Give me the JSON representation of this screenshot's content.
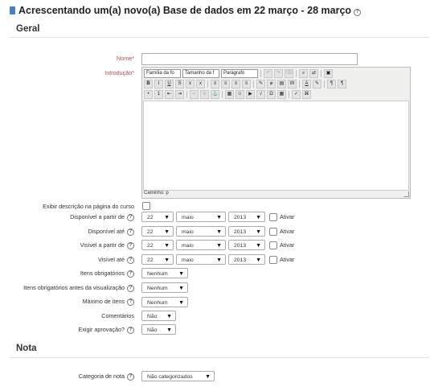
{
  "page": {
    "title": "Acrescentando um(a) novo(a) Base de dados em 22 março - 28 março",
    "help_glyph": "?"
  },
  "sections": {
    "general": "Geral",
    "grade": "Nota"
  },
  "fields": {
    "name_label": "Nome*",
    "intro_label": "Introdução*",
    "show_description_label": "Exibir descrição na página do curso",
    "available_from_label": "Disponível a partir de",
    "available_to_label": "Disponível até",
    "viewable_from_label": "Visível a partir de",
    "viewable_to_label": "Visível até",
    "required_entries_label": "Itens obrigatórios",
    "required_entries_view_label": "Itens obrigatórios antes da visualização",
    "max_entries_label": "Máximo de itens",
    "comments_label": "Comentários",
    "approval_label": "Exigir aprovação?",
    "grade_category_label": "Categoria de nota"
  },
  "date_rows": [
    {
      "day": "22",
      "month": "maio",
      "year": "2013",
      "enable": "Ativar"
    },
    {
      "day": "22",
      "month": "maio",
      "year": "2013",
      "enable": "Ativar"
    },
    {
      "day": "22",
      "month": "maio",
      "year": "2013",
      "enable": "Ativar"
    },
    {
      "day": "22",
      "month": "maio",
      "year": "2013",
      "enable": "Ativar"
    }
  ],
  "selects": {
    "required_entries": "Nenhum",
    "required_entries_view": "Nenhum",
    "max_entries": "Nenhum",
    "comments": "Não",
    "approval": "Não",
    "grade_category": "Não categorizados"
  },
  "editor": {
    "font_family": "Família da fo",
    "font_size": "Tamanho da f",
    "format": "Parágrafo",
    "path": "Caminho: p"
  },
  "colors": {
    "required": "#b94a48",
    "module_icon": "#4a7fc0"
  }
}
